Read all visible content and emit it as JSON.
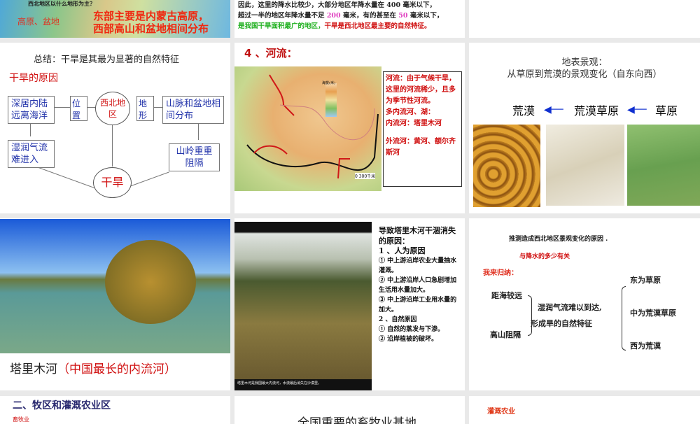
{
  "slides": {
    "s1": {
      "question": "西北地区以什么地形为主？",
      "answer_left": "高原、盆地",
      "answer_line1": "东部主要是内蒙古高原，",
      "answer_line2": "西部高山和盆地相间分布"
    },
    "s2": {
      "line1_a": "因此，这里的降水比较少，大部分地区年降水量在 400 毫米以下，",
      "line2_a": "超过一半的地区年降水量不足 ",
      "v200": "200",
      "line2_b": " 毫米，有的甚至在 ",
      "v50": "50",
      "line2_c": " 毫米以下，",
      "line3_green": "是我国干旱面积最广的地区，",
      "line3_red": "干旱是西北地区最主要的自然特征。"
    },
    "s4": {
      "summary": "总结：干旱是其最为显著的自然特征",
      "subtitle": "干旱的原因",
      "center": "西北地区",
      "pos": "位 置",
      "terrain": "地 形",
      "left1": "深居内陆远离海洋",
      "left2": "湿润气流难进入",
      "right1": "山脉和盆地相间分布",
      "right2": "山岭重重阻隔",
      "result": "干旱"
    },
    "s5": {
      "title": "4 、河流：",
      "legend_title": "海拔(米)",
      "scale": "0   300千米",
      "text1": "河流：由于气候干旱，这里的河流稀少，且多为季节性河流。",
      "text2": "多内流河、湖：",
      "text3": "内流河：塔里木河",
      "text4": "外流河：黄河、额尔齐斯河"
    },
    "s6": {
      "line1": "地表景观：",
      "line2": "从草原到荒漠的景观变化",
      "line2_suffix": "（自东向西）",
      "desert": "荒漠",
      "desert_steppe": "荒漠草原",
      "steppe": "草原"
    },
    "s7": {
      "caption_black": "塔里木河",
      "caption_red": "（中国最长的内流河）"
    },
    "s8": {
      "photo_caption": "塔里木河是我国最大内流河，水流最后消失在沙漠里。",
      "lines": [
        "导致塔里木河干涸消失的原因：",
        "1 、人为原因",
        "① 中上游沿岸农业大量抽水灌溉。",
        "② 中上游沿岸人口急剧增加生活用水量加大。",
        "③ 中上游沿岸工业用水量的加大。",
        "2 、自然原因",
        "① 自然的蒸发与下渗。",
        "② 沿岸植被的破坏。"
      ]
    },
    "s9": {
      "title": "推测造成西北地区景观变化的原因 .",
      "red1": "与降水的多少有关",
      "summarize": "我来归纳：",
      "a": "距海较远",
      "b": "高山阻隔",
      "mid1": "湿润气流难以到达,",
      "mid2": "形成旱的自然特征",
      "r1": "东为草原",
      "r2": "中为荒漠草原",
      "r3": "西为荒漠"
    },
    "s10": {
      "title": "二、牧区和灌溉农业区",
      "sub": "畜牧业"
    },
    "s11": {
      "title": "全国重要的畜牧业基地"
    },
    "s12": {
      "title": "灌溉农业"
    }
  }
}
